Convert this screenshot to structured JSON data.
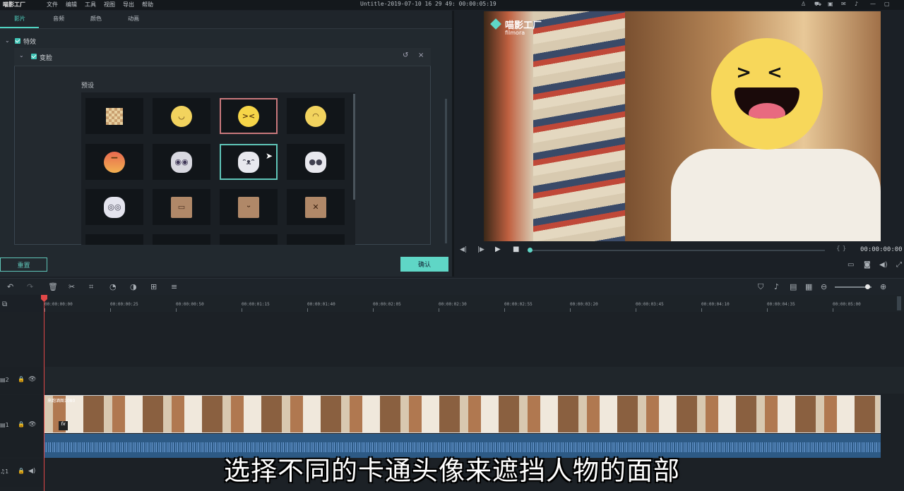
{
  "app": {
    "logo": "喵影工厂",
    "window_title": "Untitle-2019-07-10 16 29 49: 00:00:05:19"
  },
  "menu": [
    "文件",
    "编辑",
    "工具",
    "视图",
    "导出",
    "帮助"
  ],
  "window_icons": [
    "user-icon",
    "cart-icon",
    "save-icon",
    "mail-icon",
    "mic-icon",
    "minimize-icon",
    "maximize-icon"
  ],
  "tabs": [
    {
      "label": "影片",
      "active": true
    },
    {
      "label": "音频",
      "active": false
    },
    {
      "label": "颜色",
      "active": false
    },
    {
      "label": "动画",
      "active": false
    }
  ],
  "effects": {
    "section_label": "特效",
    "effect_name": "变脸",
    "presets_label": "预设"
  },
  "presets": [
    {
      "name": "mosaic",
      "selected": ""
    },
    {
      "name": "yum-face",
      "selected": ""
    },
    {
      "name": "laughing-face",
      "selected": "red"
    },
    {
      "name": "worried-face",
      "selected": ""
    },
    {
      "name": "angry-face",
      "selected": ""
    },
    {
      "name": "cat-scream",
      "selected": ""
    },
    {
      "name": "cat-face",
      "selected": "teal"
    },
    {
      "name": "cat-surprised",
      "selected": ""
    },
    {
      "name": "cat-scared",
      "selected": ""
    },
    {
      "name": "box-grumpy",
      "selected": ""
    },
    {
      "name": "box-happy",
      "selected": ""
    },
    {
      "name": "box-dizzy",
      "selected": ""
    }
  ],
  "buttons": {
    "reset": "重置",
    "ok": "确认"
  },
  "preview": {
    "watermark_cn": "喵影工厂",
    "watermark_en": "filmora",
    "timecode": "00:00:00:00",
    "progress": 0
  },
  "timeline": {
    "ruler": [
      "00:00:00:00",
      "00:00:00:25",
      "00:00:00:50",
      "00:00:01:15",
      "00:00:01:40",
      "00:00:02:05",
      "00:00:02:30",
      "00:00:02:55",
      "00:00:03:20",
      "00:00:03:45",
      "00:00:04:10",
      "00:00:04:35",
      "00:00:05:00"
    ],
    "track_labels": [
      "2",
      "1",
      "1"
    ],
    "clip_name": "来跑酒图1080"
  },
  "subtitle": "选择不同的卡通头像来遮挡人物的面部",
  "colors": {
    "accent": "#4fd3c1",
    "playhead": "#e04848"
  }
}
